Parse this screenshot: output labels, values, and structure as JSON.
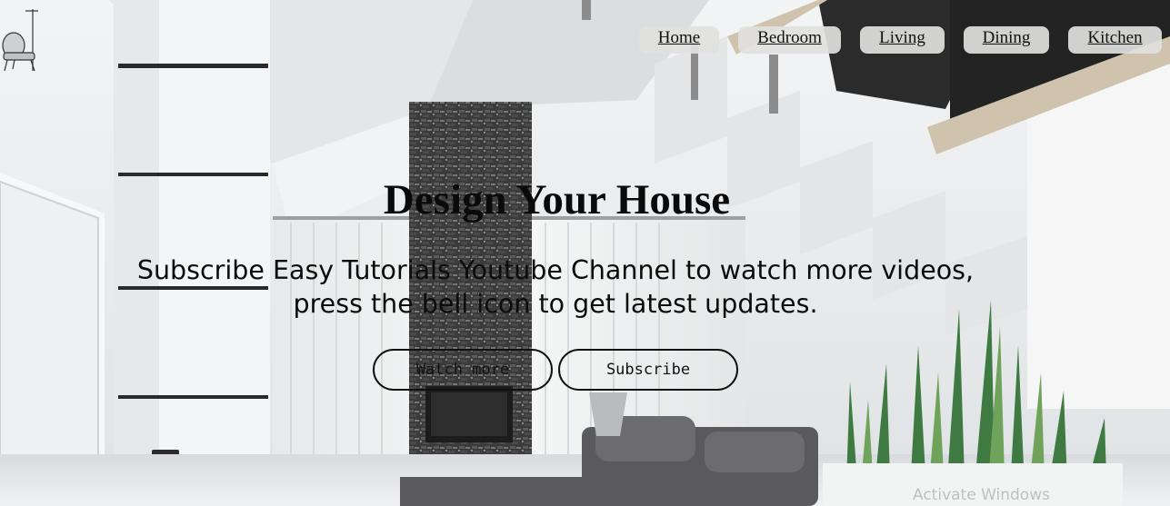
{
  "nav": {
    "items": [
      {
        "label": "Home"
      },
      {
        "label": "Bedroom"
      },
      {
        "label": "Living"
      },
      {
        "label": "Dining"
      },
      {
        "label": "Kitchen"
      }
    ]
  },
  "hero": {
    "title": "Design Your House",
    "subtitle_line1": "Subscribe Easy Tutorials Youtube Channel to watch more videos,",
    "subtitle_line2": "press the bell icon to get latest updates."
  },
  "buttons": {
    "watch_more": "Watch more",
    "subscribe": "Subscribe"
  },
  "watermark": "Activate Windows",
  "icons": {
    "logo": "armchair-lamp-icon"
  },
  "colors": {
    "text": "#0a0a0a",
    "nav_background": "#e1e1de",
    "button_border": "#111111"
  }
}
